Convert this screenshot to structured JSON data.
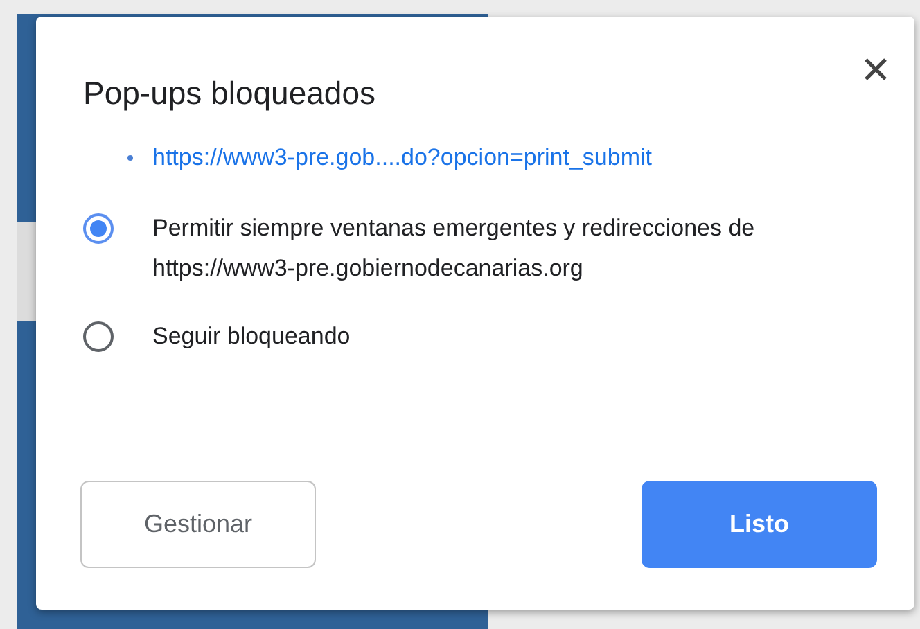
{
  "dialog": {
    "title": "Pop-ups bloqueados",
    "blocked_urls": [
      "https://www3-pre.gob....do?opcion=print_submit"
    ],
    "options": [
      {
        "label": "Permitir siempre ventanas emergentes y redirecciones de https://www3-pre.gobiernodecanarias.org",
        "selected": true
      },
      {
        "label": "Seguir bloqueando",
        "selected": false
      }
    ],
    "buttons": [
      {
        "label": "Gestionar",
        "kind": "secondary"
      },
      {
        "label": "Listo",
        "kind": "primary"
      }
    ]
  }
}
